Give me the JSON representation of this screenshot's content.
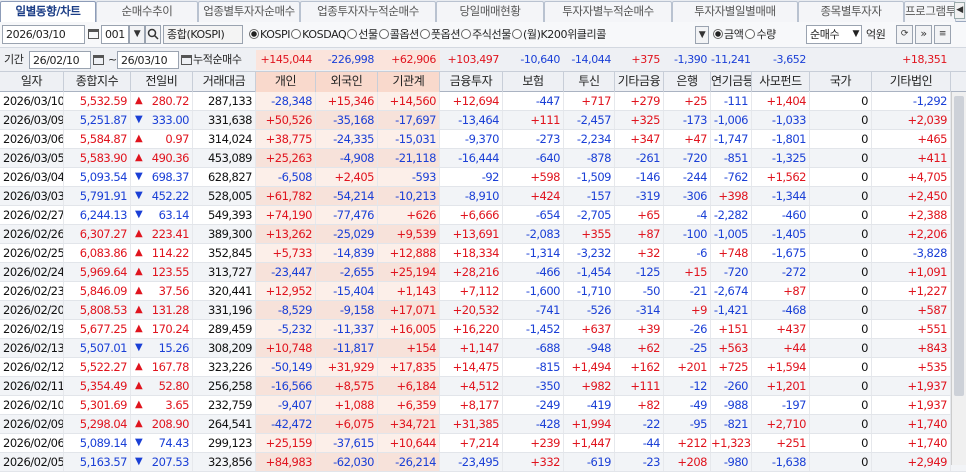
{
  "tabs": [
    "일별동향/차트",
    "순매수추이",
    "업종별투자자순매수",
    "업종투자자누적순매수",
    "당일매매현황",
    "투자자별누적순매수",
    "투자자별일별매매",
    "종목별투자자",
    "프로그램투자자"
  ],
  "toolbar": {
    "date": "2026/03/10",
    "code": "001",
    "market_name": "종합(KOSPI)",
    "radios": [
      "KOSPI",
      "KOSDAQ",
      "선물",
      "콜옵션",
      "풋옵션",
      "주식선물",
      "(월)K200위클리콜"
    ],
    "selected_radio": "KOSPI",
    "unit_radios": [
      "금액",
      "수량"
    ],
    "selected_unit": "금액",
    "sort_select": "순매수",
    "unit_label": "억원"
  },
  "period": {
    "label": "기간",
    "from": "26/02/10",
    "tilde": "~",
    "to": "26/03/10",
    "cum_label": "누적순매수",
    "values": [
      "+145,044",
      "-226,998",
      "+62,906",
      "+103,497",
      "-10,640",
      "-14,044",
      "+375",
      "-1,390",
      "-11,241",
      "-3,652",
      "",
      "+18,351"
    ]
  },
  "columns": [
    "일자",
    "종합지수",
    "전일비",
    "거래대금",
    "개인",
    "외국인",
    "기관계",
    "금융투자",
    "보험",
    "투신",
    "기타금융",
    "은행",
    "연기금등",
    "사모펀드",
    "국가",
    "기타법인"
  ],
  "rows": [
    [
      "2026/03/10",
      "5,532.59",
      "▲",
      "280.72",
      "287,133",
      "-28,348",
      "+15,346",
      "+14,560",
      "+12,694",
      "-447",
      "+717",
      "+279",
      "+25",
      "-111",
      "+1,404",
      "0",
      "-1,292"
    ],
    [
      "2026/03/09",
      "5,251.87",
      "▼",
      "333.00",
      "331,638",
      "+50,526",
      "-35,168",
      "-17,697",
      "-13,464",
      "+111",
      "-2,457",
      "+325",
      "-173",
      "-1,006",
      "-1,033",
      "0",
      "+2,039"
    ],
    [
      "2026/03/06",
      "5,584.87",
      "▲",
      "0.97",
      "314,024",
      "+38,775",
      "-24,335",
      "-15,031",
      "-9,370",
      "-273",
      "-2,234",
      "+347",
      "+47",
      "-1,747",
      "-1,801",
      "0",
      "+465"
    ],
    [
      "2026/03/05",
      "5,583.90",
      "▲",
      "490.36",
      "453,089",
      "+25,263",
      "-4,908",
      "-21,118",
      "-16,444",
      "-640",
      "-878",
      "-261",
      "-720",
      "-851",
      "-1,325",
      "0",
      "+411"
    ],
    [
      "2026/03/04",
      "5,093.54",
      "▼",
      "698.37",
      "628,827",
      "-6,508",
      "+2,405",
      "-593",
      "-92",
      "+598",
      "-1,509",
      "-146",
      "-244",
      "-762",
      "+1,562",
      "0",
      "+4,705"
    ],
    [
      "2026/03/03",
      "5,791.91",
      "▼",
      "452.22",
      "528,005",
      "+61,782",
      "-54,214",
      "-10,213",
      "-8,910",
      "+424",
      "-157",
      "-319",
      "-306",
      "+398",
      "-1,344",
      "0",
      "+2,450"
    ],
    [
      "2026/02/27",
      "6,244.13",
      "▼",
      "63.14",
      "549,393",
      "+74,190",
      "-77,476",
      "+626",
      "+6,666",
      "-654",
      "-2,705",
      "+65",
      "-4",
      "-2,282",
      "-460",
      "0",
      "+2,388"
    ],
    [
      "2026/02/26",
      "6,307.27",
      "▲",
      "223.41",
      "389,300",
      "+13,262",
      "-25,029",
      "+9,539",
      "+13,691",
      "-2,083",
      "+355",
      "+87",
      "-100",
      "-1,005",
      "-1,405",
      "0",
      "+2,206"
    ],
    [
      "2026/02/25",
      "6,083.86",
      "▲",
      "114.22",
      "352,845",
      "+5,733",
      "-14,839",
      "+12,888",
      "+18,334",
      "-1,314",
      "-3,232",
      "+32",
      "-6",
      "+748",
      "-1,675",
      "0",
      "-3,828"
    ],
    [
      "2026/02/24",
      "5,969.64",
      "▲",
      "123.55",
      "313,727",
      "-23,447",
      "-2,655",
      "+25,194",
      "+28,216",
      "-466",
      "-1,454",
      "-125",
      "+15",
      "-720",
      "-272",
      "0",
      "+1,091"
    ],
    [
      "2026/02/23",
      "5,846.09",
      "▲",
      "37.56",
      "320,441",
      "+12,952",
      "-15,404",
      "+1,143",
      "+7,112",
      "-1,600",
      "-1,710",
      "-50",
      "-21",
      "-2,674",
      "+87",
      "0",
      "+1,227"
    ],
    [
      "2026/02/20",
      "5,808.53",
      "▲",
      "131.28",
      "331,196",
      "-8,529",
      "-9,158",
      "+17,071",
      "+20,532",
      "-741",
      "-526",
      "-314",
      "+9",
      "-1,421",
      "-468",
      "0",
      "+587"
    ],
    [
      "2026/02/19",
      "5,677.25",
      "▲",
      "170.24",
      "289,459",
      "-5,232",
      "-11,337",
      "+16,005",
      "+16,220",
      "-1,452",
      "+637",
      "+39",
      "-26",
      "+151",
      "+437",
      "0",
      "+551"
    ],
    [
      "2026/02/13",
      "5,507.01",
      "▼",
      "15.26",
      "308,209",
      "+10,748",
      "-11,817",
      "+154",
      "+1,147",
      "-688",
      "-948",
      "+62",
      "-25",
      "+563",
      "+44",
      "0",
      "+843"
    ],
    [
      "2026/02/12",
      "5,522.27",
      "▲",
      "167.78",
      "323,226",
      "-50,149",
      "+31,929",
      "+17,835",
      "+14,475",
      "-815",
      "+1,494",
      "+162",
      "+201",
      "+725",
      "+1,594",
      "0",
      "+535"
    ],
    [
      "2026/02/11",
      "5,354.49",
      "▲",
      "52.80",
      "256,258",
      "-16,566",
      "+8,575",
      "+6,184",
      "+4,512",
      "-350",
      "+982",
      "+111",
      "-12",
      "-260",
      "+1,201",
      "0",
      "+1,937"
    ],
    [
      "2026/02/10",
      "5,301.69",
      "▲",
      "3.65",
      "232,759",
      "-9,407",
      "+1,088",
      "+6,359",
      "+8,177",
      "-249",
      "-419",
      "+82",
      "-49",
      "-988",
      "-197",
      "0",
      "+1,937"
    ],
    [
      "2026/02/09",
      "5,298.04",
      "▲",
      "208.90",
      "264,541",
      "-42,472",
      "+6,075",
      "+34,721",
      "+31,385",
      "-428",
      "+1,994",
      "-22",
      "-95",
      "-821",
      "+2,710",
      "0",
      "+1,740"
    ],
    [
      "2026/02/06",
      "5,089.14",
      "▼",
      "74.43",
      "299,123",
      "+25,159",
      "-37,615",
      "+10,644",
      "+7,214",
      "+239",
      "+1,447",
      "-44",
      "+212",
      "+1,323",
      "+251",
      "0",
      "+1,740"
    ],
    [
      "2026/02/05",
      "5,163.57",
      "▼",
      "207.53",
      "323,856",
      "+84,983",
      "-62,030",
      "-26,214",
      "-23,495",
      "+332",
      "-619",
      "-23",
      "+208",
      "-980",
      "-1,638",
      "0",
      "+2,949"
    ]
  ],
  "colors": {
    "up": "#e0141e",
    "down": "#1a3fd6",
    "header_bg": "#eef0f4",
    "highlight_bg": "#fcefe9",
    "alt_row": "#f2f4f7"
  }
}
